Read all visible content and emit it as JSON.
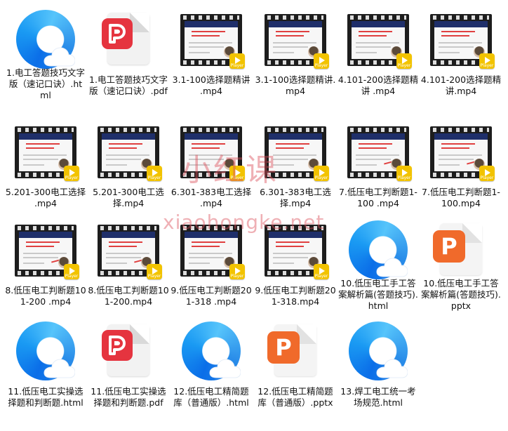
{
  "files": [
    {
      "name": "1.电工答题技巧文字版（速记口诀）.html",
      "type": "html"
    },
    {
      "name": "1.电工答题技巧文字版（速记口诀）.pdf",
      "type": "pdf"
    },
    {
      "name": "3.1-100选择题精讲 .mp4",
      "type": "mp4"
    },
    {
      "name": "3.1-100选择题精讲.mp4",
      "type": "mp4"
    },
    {
      "name": "4.101-200选择题精讲 .mp4",
      "type": "mp4"
    },
    {
      "name": "4.101-200选择题精讲.mp4",
      "type": "mp4"
    },
    {
      "name": "5.201-300电工选择 .mp4",
      "type": "mp4"
    },
    {
      "name": "5.201-300电工选择.mp4",
      "type": "mp4"
    },
    {
      "name": "6.301-383电工选择 .mp4",
      "type": "mp4"
    },
    {
      "name": "6.301-383电工选择.mp4",
      "type": "mp4"
    },
    {
      "name": "7.低压电工判断题1-100 .mp4",
      "type": "mp4"
    },
    {
      "name": "7.低压电工判断题1-100.mp4",
      "type": "mp4"
    },
    {
      "name": "8.低压电工判断题101-200 .mp4",
      "type": "mp4"
    },
    {
      "name": "8.低压电工判断题101-200.mp4",
      "type": "mp4"
    },
    {
      "name": "9.低压电工判断题201-318 .mp4",
      "type": "mp4"
    },
    {
      "name": "9.低压电工判断题201-318.mp4",
      "type": "mp4"
    },
    {
      "name": "10.低压电工手工答案解析篇(答题技巧).html",
      "type": "html"
    },
    {
      "name": "10.低压电工手工答案解析篇(答题技巧).pptx",
      "type": "pptx"
    },
    {
      "name": "11.低压电工实操选择题和判断题.html",
      "type": "html"
    },
    {
      "name": "11.低压电工实操选择题和判断题.pdf",
      "type": "pdf"
    },
    {
      "name": "12.低压电工精简题库（普通版）.html",
      "type": "html"
    },
    {
      "name": "12.低压电工精简题库（普通版）.pptx",
      "type": "pptx"
    },
    {
      "name": "13.焊工电工统一考场规范.html",
      "type": "html"
    }
  ],
  "icons": {
    "html": "browser-html-icon",
    "pdf": "pdf-icon",
    "pptx": "pptx-icon",
    "mp4": "video-thumbnail-icon"
  },
  "player_label": "Player",
  "watermark": {
    "line1": "小红课",
    "line2": "xiaohongke.net"
  }
}
